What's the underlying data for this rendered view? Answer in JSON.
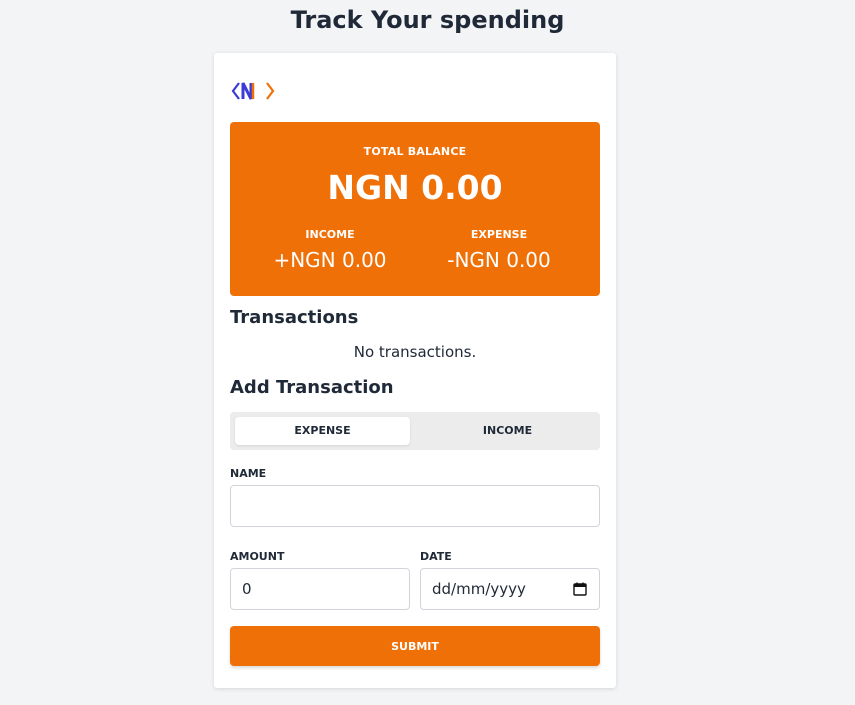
{
  "page": {
    "title": "Track Your spending"
  },
  "balance": {
    "label": "TOTAL BALANCE",
    "amount": "NGN 0.00",
    "income_label": "INCOME",
    "income_amount": "+NGN 0.00",
    "expense_label": "EXPENSE",
    "expense_amount": "-NGN 0.00"
  },
  "transactions": {
    "title": "Transactions",
    "empty_message": "No transactions."
  },
  "form": {
    "title": "Add Transaction",
    "type_toggle": {
      "options": [
        "EXPENSE",
        "INCOME"
      ],
      "selected": "EXPENSE"
    },
    "name_label": "NAME",
    "name_value": "",
    "amount_label": "AMOUNT",
    "amount_value": "0",
    "date_label": "DATE",
    "date_placeholder": "dd/mm/yyyy",
    "submit_label": "SUBMIT"
  },
  "colors": {
    "accent": "#f07008",
    "background": "#f3f4f6",
    "text": "#1f2937"
  },
  "icons": {
    "logo": "nf-logo-icon",
    "date": "calendar-icon"
  }
}
